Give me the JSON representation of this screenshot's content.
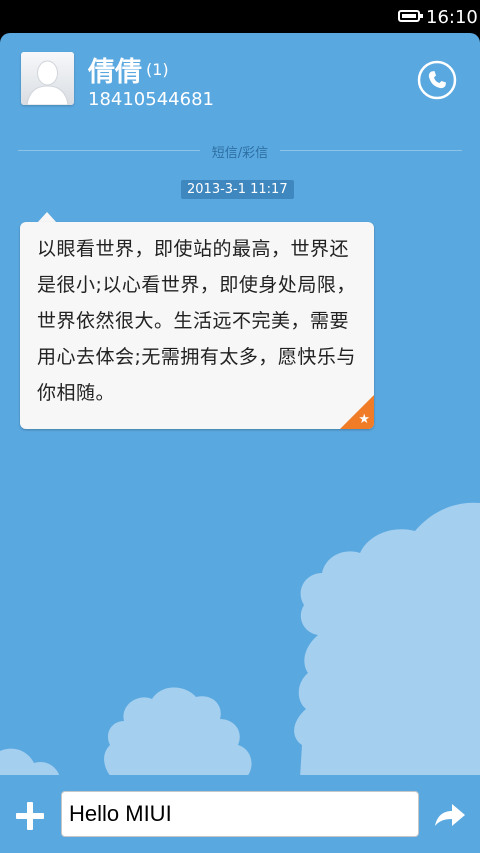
{
  "status_bar": {
    "time": "16:10",
    "battery_level": 1.0,
    "battery_icon": "battery-icon"
  },
  "contact": {
    "name": "倩倩",
    "unread_count": "(1)",
    "phone": "18410544681",
    "avatar_icon": "person-silhouette-icon",
    "call_icon": "phone-icon"
  },
  "thread": {
    "channel_label": "短信/彩信",
    "messages": [
      {
        "timestamp": "2013-3-1 11:17",
        "text": "以眼看世界，即使站的最高，世界还是很小;以心看世界，即使身处局限，世界依然很大。生活远不完美，需要用心去体会;无需拥有太多，愿快乐与你相随。",
        "starred": true,
        "star_icon": "star-icon"
      }
    ]
  },
  "composer": {
    "input_value": "Hello MIUI",
    "add_icon": "plus-icon",
    "send_icon": "send-arrow-icon"
  },
  "colors": {
    "background": "#5aa8e0",
    "cloud": "#a4cfee",
    "star_badge": "#f07c27",
    "timestamp_bg": "#3f87bf"
  }
}
